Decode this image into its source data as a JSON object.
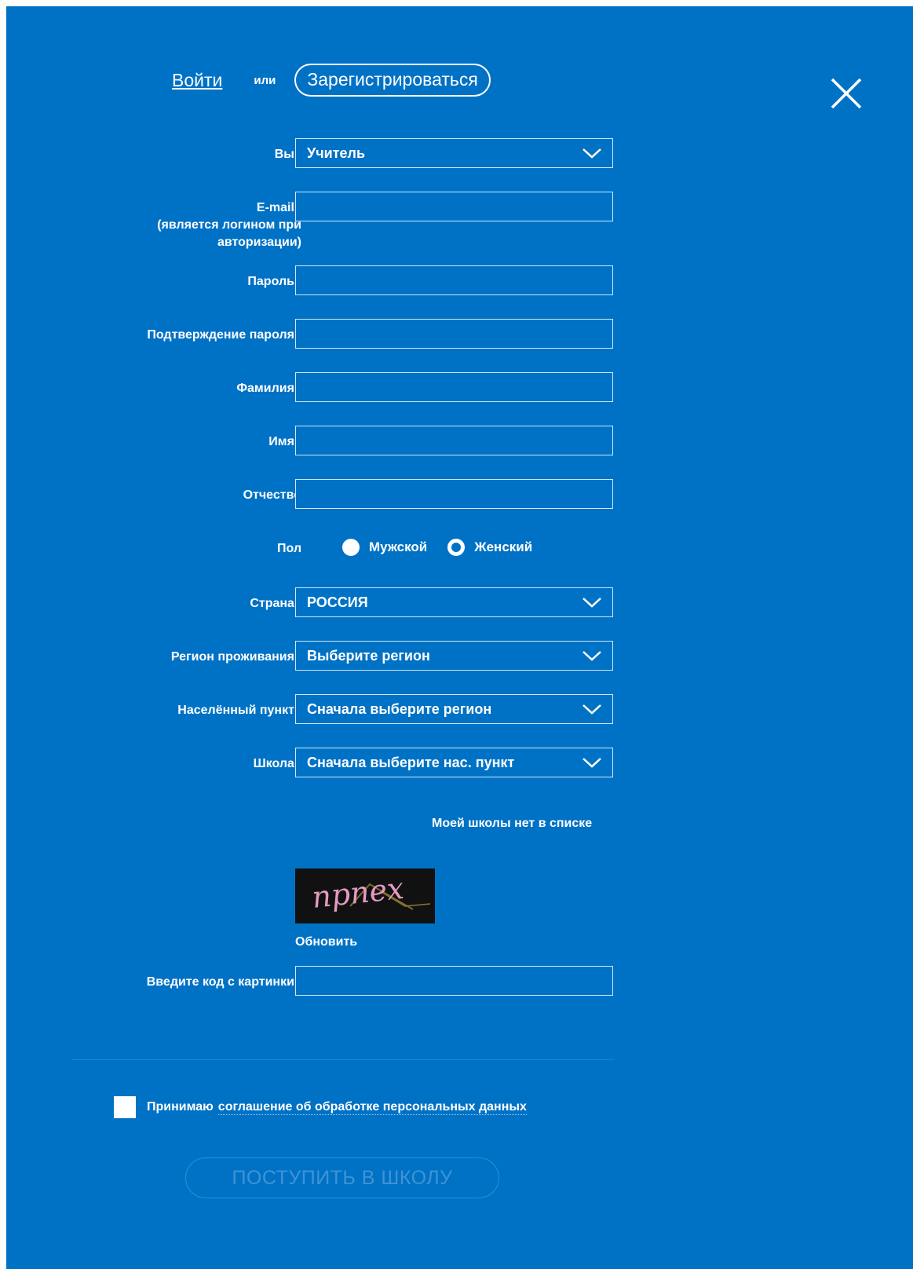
{
  "colors": {
    "background": "#0072c6",
    "required": "#e8403a",
    "text": "#ffffff",
    "disabled_button": "#3f93d3"
  },
  "header": {
    "login_label": "Войти",
    "or_label": "или",
    "register_label": "Зарегистрироваться",
    "close_icon": "close-icon"
  },
  "form": {
    "role": {
      "label": "Вы",
      "value": "Учитель"
    },
    "email": {
      "label": "E-mail",
      "hint_line1": "(является логином при",
      "hint_line2": "авторизации)",
      "value": ""
    },
    "password": {
      "label": "Пароль",
      "value": ""
    },
    "password_confirm": {
      "label": "Подтверждение пароля",
      "value": ""
    },
    "last_name": {
      "label": "Фамилия",
      "value": ""
    },
    "first_name": {
      "label": "Имя",
      "value": ""
    },
    "middle_name": {
      "label": "Отчество",
      "value": ""
    },
    "gender": {
      "label": "Пол",
      "male": "Мужской",
      "female": "Женский",
      "selected": "Женский"
    },
    "country": {
      "label": "Страна",
      "value": "РОССИЯ"
    },
    "region": {
      "label": "Регион проживания",
      "value": "Выберите регион"
    },
    "city": {
      "label": "Населённый пункт",
      "value": "Сначала выберите регион"
    },
    "school": {
      "label": "Школа",
      "value": "Сначала выберите нас. пункт"
    },
    "no_school_link": "Моей школы нет в списке",
    "captcha_text": "npnex",
    "refresh_label": "Обновить",
    "captcha_input": {
      "label": "Введите код с картинки",
      "value": ""
    },
    "required_mark": "*"
  },
  "agreement": {
    "prefix": "Принимаю",
    "link": "соглашение об обработке персональных данных",
    "checked": false
  },
  "submit_label": "ПОСТУПИТЬ В ШКОЛУ"
}
